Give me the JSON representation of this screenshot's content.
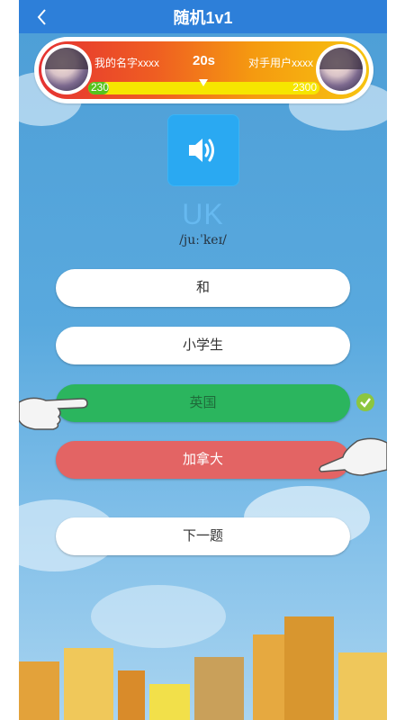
{
  "header": {
    "title": "随机1v1",
    "back_icon": "chevron-left-icon"
  },
  "battle": {
    "my_name": "我的名字xxxx",
    "opponent_name": "对手用户xxxx",
    "timer": "20s",
    "my_score": "230",
    "opponent_score": "2300",
    "my_score_fraction": 0.09
  },
  "question": {
    "speaker_icon": "speaker-icon",
    "word": "UK",
    "phonetic": "/juːˈkeɪ/"
  },
  "options": [
    {
      "label": "和",
      "state": "normal"
    },
    {
      "label": "小学生",
      "state": "normal"
    },
    {
      "label": "英国",
      "state": "correct"
    },
    {
      "label": "加拿大",
      "state": "wrong"
    }
  ],
  "next_button": {
    "label": "下一题"
  },
  "colors": {
    "header": "#2d7fd9",
    "correct": "#2bb55e",
    "wrong": "#e36464",
    "speaker": "#2aa9f2"
  }
}
